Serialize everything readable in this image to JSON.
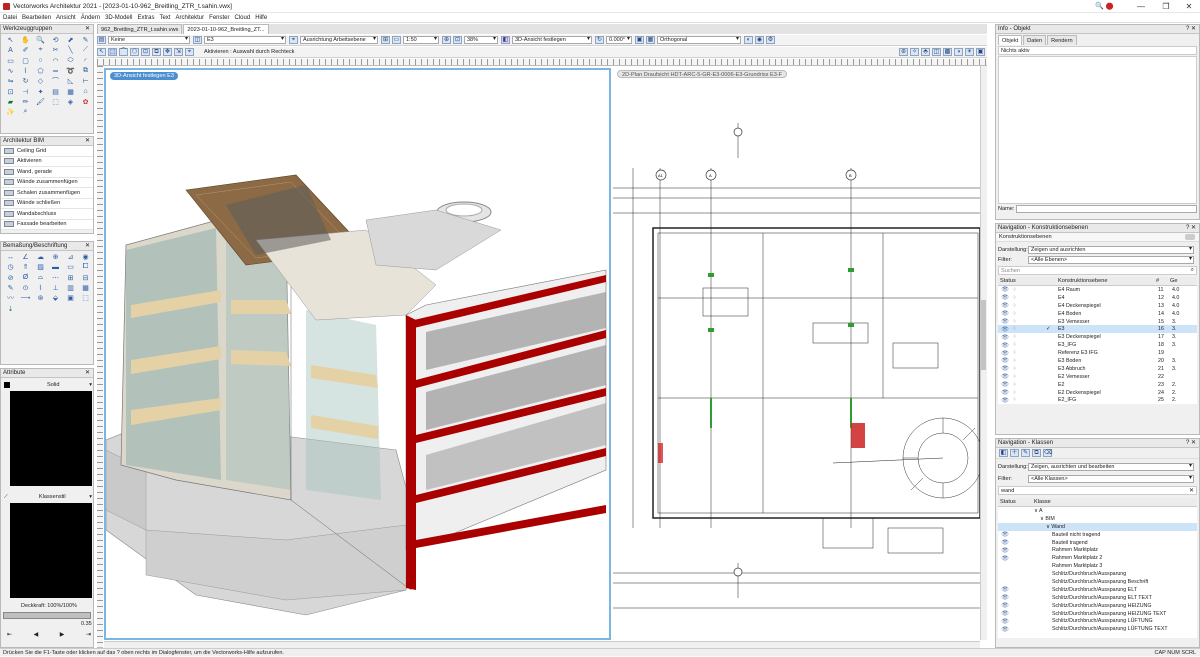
{
  "window": {
    "title": "Vectorworks Architektur 2021 - [2023-01-10-962_Breitling_ZTR_t.sahin.vwx]"
  },
  "menu": [
    "Datei",
    "Bearbeiten",
    "Ansicht",
    "Ändern",
    "3D-Modell",
    "Extras",
    "Text",
    "Architektur",
    "Fenster",
    "Cloud",
    "Hilfe"
  ],
  "tool_palette": {
    "title": "Werkzeuggruppen"
  },
  "bim": {
    "title": "Architektur BIM",
    "items": [
      "Ceiling Grid",
      "Aktivieren",
      "Wand, gerade",
      "Wände zusammenfügen",
      "Schalen zusammenfügen",
      "Wände schließen",
      "Wandabschluss",
      "Fassade bearbeiten"
    ]
  },
  "dims": {
    "title": "Bemaßung/Beschriftung"
  },
  "attr": {
    "title": "Attribute",
    "fill": "Solid",
    "line": "Klassenstil",
    "opacity": "Deckkraft: 100%/100%",
    "thickness": "0.35"
  },
  "tabs": [
    "962_Breitling_ZTR_t.sahin.vwx",
    "2023-01-10-962_Breitling_ZT..."
  ],
  "toolbar": {
    "class": "Keine",
    "layer": "E3",
    "align": "Ausrichtung Arbeitsebene",
    "scale": "1:50",
    "zoom": "38%",
    "view": "3D-Ansicht festlegen",
    "angle": "0.000°",
    "projection": "Orthogonal",
    "hint": "Aktivieren : Auswahl durch Rechteck"
  },
  "viewport_left": {
    "label": "3D-Ansicht festlegen  E3"
  },
  "viewport_right": {
    "label": "2D-Plan Draufsicht  HDT-ARC-5-GR-E3-0006-E3-Grundriss E3-F",
    "axis_labels": [
      "A1",
      "A",
      "B"
    ]
  },
  "info": {
    "title": "Info - Objekt",
    "tabs": [
      "Objekt",
      "Daten",
      "Rendern"
    ],
    "status": "Nichts aktiv",
    "name_label": "Name:"
  },
  "nav_levels": {
    "title": "Navigation - Konstruktionsebenen",
    "subtitle": "Konstruktionsebenen",
    "darstellung_label": "Darstellung:",
    "darstellung": "Zeigen und ausrichten",
    "filter_label": "Filter:",
    "filter": "<Alle Ebenen>",
    "search": "Suchen",
    "columns": [
      "Status",
      "Konstruktionsebene",
      "#",
      "Ge"
    ],
    "rows": [
      {
        "name": "E4 Raum",
        "num": "11",
        "ge": "4.0",
        "vis": "",
        "mark": "",
        "hl": false
      },
      {
        "name": "E4",
        "num": "12",
        "ge": "4.0",
        "vis": "",
        "mark": "",
        "hl": false
      },
      {
        "name": "E4 Deckenspiegel",
        "num": "13",
        "ge": "4.0",
        "vis": "",
        "mark": "",
        "hl": false
      },
      {
        "name": "E4 Boden",
        "num": "14",
        "ge": "4.0",
        "vis": "",
        "mark": "",
        "hl": false
      },
      {
        "name": "E3 Vemesser",
        "num": "15",
        "ge": "3.",
        "vis": "",
        "mark": "",
        "hl": false
      },
      {
        "name": "E3",
        "num": "16",
        "ge": "3.",
        "vis": "👁",
        "mark": "✓",
        "hl": true
      },
      {
        "name": "E3 Deckenspiegel",
        "num": "17",
        "ge": "3.",
        "vis": "",
        "mark": "",
        "hl": false
      },
      {
        "name": "E3_IFG",
        "num": "18",
        "ge": "3.",
        "vis": "",
        "mark": "",
        "hl": false
      },
      {
        "name": "Referenz E3 IFG",
        "num": "19",
        "ge": "",
        "vis": "",
        "mark": "",
        "hl": false
      },
      {
        "name": "E3 Boden",
        "num": "20",
        "ge": "3.",
        "vis": "",
        "mark": "",
        "hl": false
      },
      {
        "name": "E3 Abbruch",
        "num": "21",
        "ge": "3.",
        "vis": "",
        "mark": "",
        "hl": false
      },
      {
        "name": "E2 Vemesser",
        "num": "22",
        "ge": "",
        "vis": "",
        "mark": "",
        "hl": false
      },
      {
        "name": "E2",
        "num": "23",
        "ge": "2.",
        "vis": "",
        "mark": "",
        "hl": false
      },
      {
        "name": "E2 Deckenspiegel",
        "num": "24",
        "ge": "2.",
        "vis": "",
        "mark": "",
        "hl": false
      },
      {
        "name": "E2_IFG",
        "num": "25",
        "ge": "2.",
        "vis": "",
        "mark": "",
        "hl": false
      }
    ]
  },
  "nav_classes": {
    "title": "Navigation - Klassen",
    "darstellung_label": "Darstellung:",
    "darstellung": "Zeigen, ausrichten und bearbeiten",
    "filter_label": "Filter:",
    "filter": "<Alle Klassen>",
    "search": "wand",
    "columns": [
      "Status",
      "Klasse"
    ],
    "rows": [
      {
        "name": "∨ A",
        "indent": 0,
        "hl": false,
        "vis": ""
      },
      {
        "name": "∨ BIM",
        "indent": 1,
        "hl": false,
        "vis": ""
      },
      {
        "name": "∨ Wand",
        "indent": 2,
        "hl": true,
        "vis": ""
      },
      {
        "name": "Bauteil nicht tragend",
        "indent": 3,
        "hl": false,
        "vis": "👁"
      },
      {
        "name": "Bauteil tragend",
        "indent": 3,
        "hl": false,
        "vis": "👁"
      },
      {
        "name": "Rahmen Marktplatz",
        "indent": 3,
        "hl": false,
        "vis": "👁"
      },
      {
        "name": "Rahmen Marktplatz 2",
        "indent": 3,
        "hl": false,
        "vis": "👁"
      },
      {
        "name": "Rahmen Marktplatz 3",
        "indent": 3,
        "hl": false,
        "vis": ""
      },
      {
        "name": "Schlitz/Durchbruch/Aussparung",
        "indent": 3,
        "hl": false,
        "vis": ""
      },
      {
        "name": "Schlitz/Durchbruch/Aussparung Beschrift",
        "indent": 3,
        "hl": false,
        "vis": ""
      },
      {
        "name": "Schlitz/Durchbruch/Aussparung ELT",
        "indent": 3,
        "hl": false,
        "vis": "👁"
      },
      {
        "name": "Schlitz/Durchbruch/Aussparung ELT TEXT",
        "indent": 3,
        "hl": false,
        "vis": "👁"
      },
      {
        "name": "Schlitz/Durchbruch/Aussparung HEIZUNG",
        "indent": 3,
        "hl": false,
        "vis": "👁"
      },
      {
        "name": "Schlitz/Durchbruch/Aussparung HEIZUNG TEXT",
        "indent": 3,
        "hl": false,
        "vis": "👁"
      },
      {
        "name": "Schlitz/Durchbruch/Aussparung LÜFTUNG",
        "indent": 3,
        "hl": false,
        "vis": "👁"
      },
      {
        "name": "Schlitz/Durchbruch/Aussparung LÜFTUNG TEXT",
        "indent": 3,
        "hl": false,
        "vis": "👁"
      }
    ]
  },
  "statusbar": {
    "text": "Drücken Sie die F1-Taste oder klicken auf das ? oben rechts im Dialogfenster, um die Vectorworks-Hilfe aufzurufen.",
    "right": "CAP NUM SCRL"
  }
}
